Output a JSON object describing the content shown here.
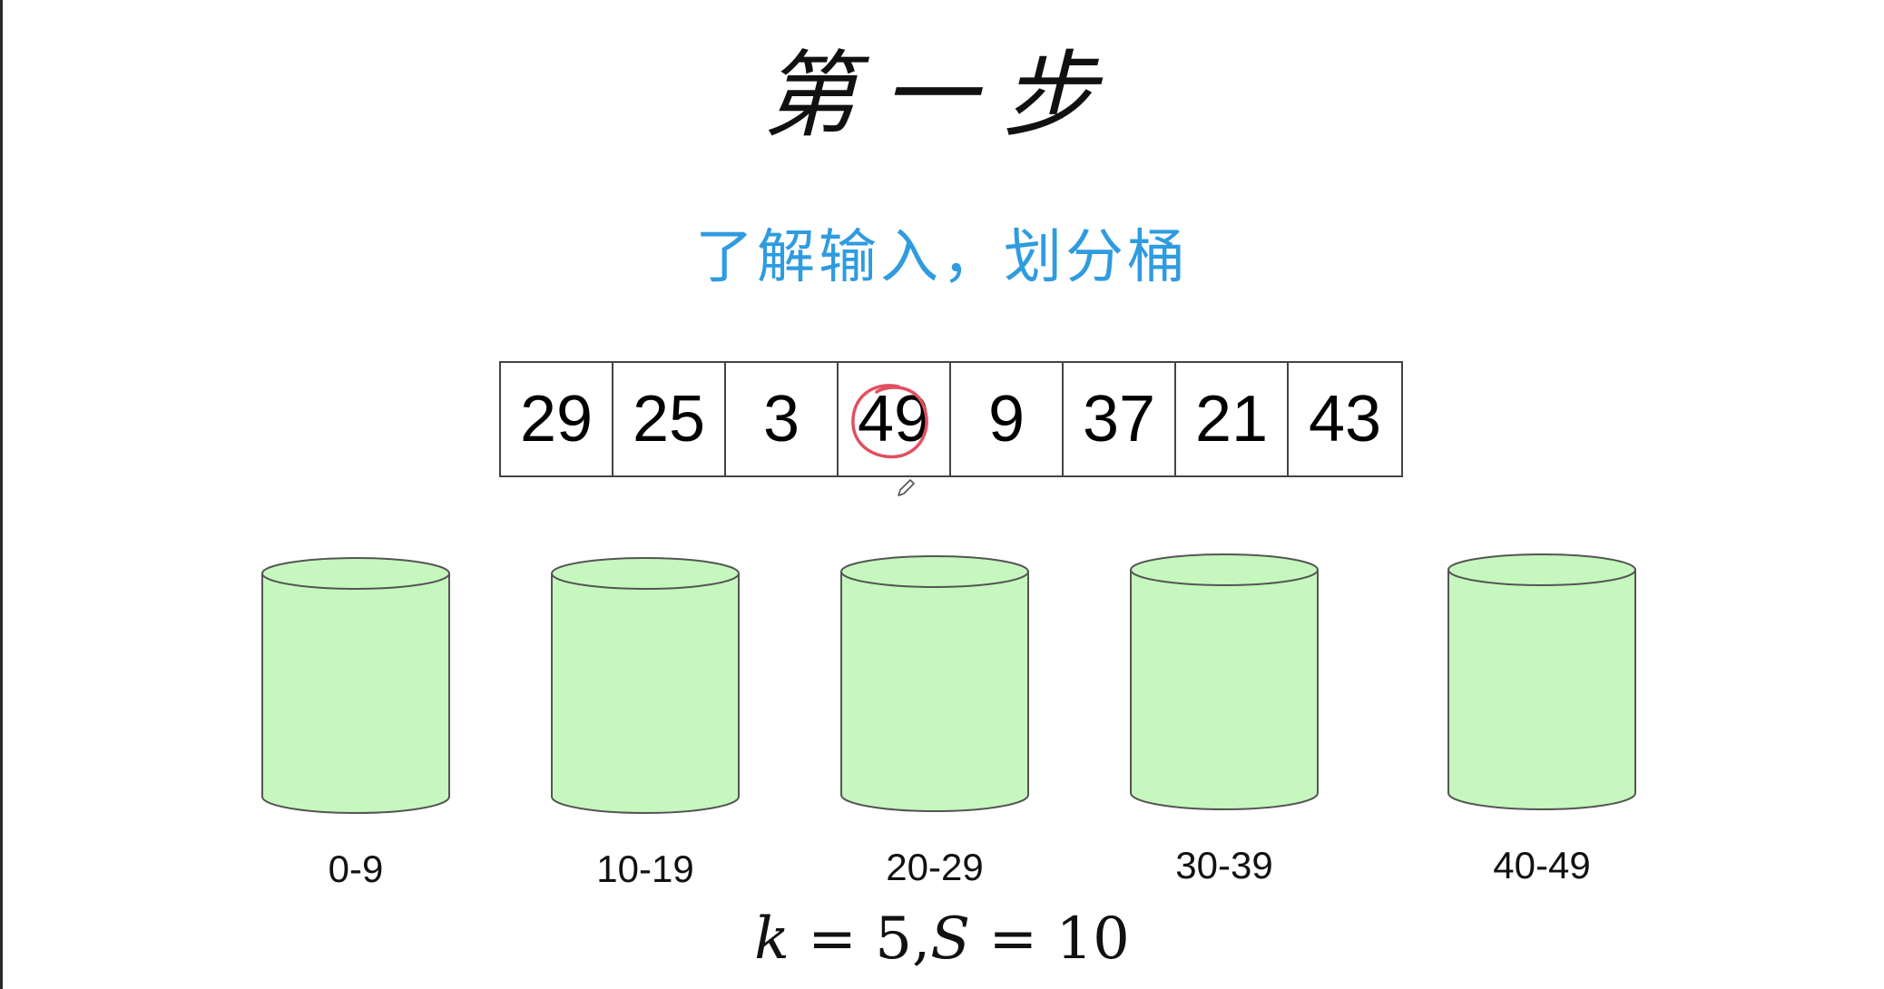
{
  "title": "第一步",
  "subtitle": "了解输入，划分桶",
  "array": {
    "values": [
      "29",
      "25",
      "3",
      "49",
      "9",
      "37",
      "21",
      "43"
    ],
    "highlighted_index": 3,
    "highlight_color": "#e05060"
  },
  "buckets": {
    "fill_color": "#c6f7be",
    "labels": [
      "0-9",
      "10-19",
      "20-29",
      "30-39",
      "40-49"
    ]
  },
  "formula": {
    "k_var": "k",
    "k_value": "5",
    "s_var": "S",
    "s_value": "10"
  },
  "colors": {
    "subtitle": "#2f9be0",
    "cell_border": "#444444"
  }
}
